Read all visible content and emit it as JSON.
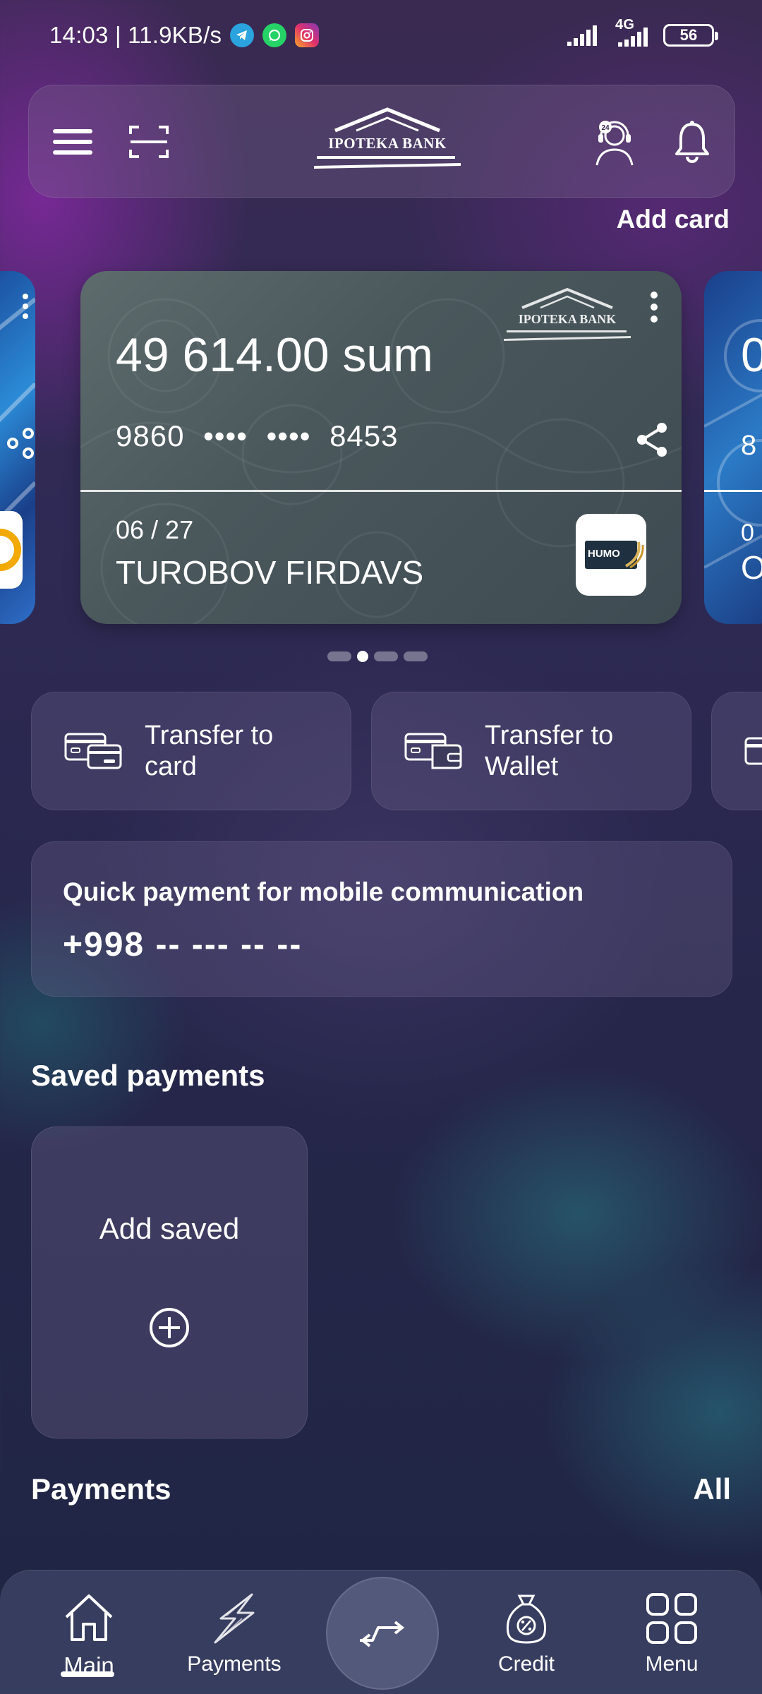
{
  "status_bar": {
    "time_speed": "14:03 | 11.9KB/s",
    "network": "4G",
    "battery": "56"
  },
  "header": {
    "logo_text": "IPOTEKA BANK"
  },
  "add_card_label": "Add card",
  "card": {
    "balance": "49 614.00 sum",
    "number": "9860 •••• •••• 8453",
    "expiry": "06 / 27",
    "holder": "TUROBOV FIRDAVS",
    "logo_text": "IPOTEKA BANK",
    "payment_system": "HUMO"
  },
  "carousel": {
    "count": 4,
    "active_index": 1
  },
  "actions": [
    {
      "label_line1": "Transfer to",
      "label_line2": "card"
    },
    {
      "label_line1": "Transfer to",
      "label_line2": "Wallet"
    }
  ],
  "quick_payment": {
    "title": "Quick payment for mobile communication",
    "phone_placeholder": "+998 -- --- -- --"
  },
  "saved_payments": {
    "title": "Saved payments",
    "add_label": "Add saved"
  },
  "payments": {
    "title": "Payments",
    "all_label": "All"
  },
  "bottom_nav": {
    "main": "Main",
    "payments": "Payments",
    "credit": "Credit",
    "menu": "Menu"
  },
  "colors": {
    "card_bg": "#4a585c",
    "tile_bg": "rgba(110,100,140,0.32)",
    "nav_bg": "#3c4264",
    "telegram": "#2aa3df",
    "whatsapp": "#25d366",
    "instagram": "#e1306c"
  }
}
